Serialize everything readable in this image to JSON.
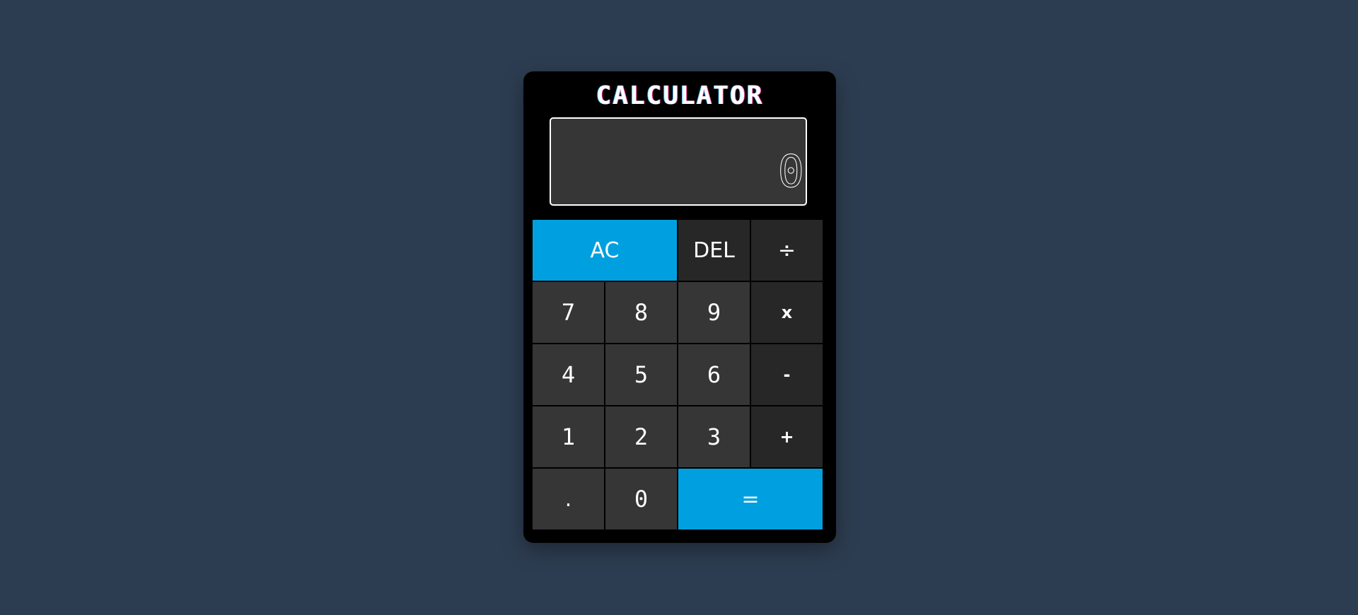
{
  "app": {
    "title": "CALCULATOR"
  },
  "display": {
    "value": "0"
  },
  "colors": {
    "background": "#2d3d51",
    "body": "#000000",
    "key": "#363636",
    "operator_key": "#272727",
    "accent": "#00a0e0",
    "text": "#ffffff"
  },
  "keys": {
    "clear": "AC",
    "delete": "DEL",
    "divide": "÷",
    "seven": "7",
    "eight": "8",
    "nine": "9",
    "multiply": "x",
    "four": "4",
    "five": "5",
    "six": "6",
    "subtract": "-",
    "one": "1",
    "two": "2",
    "three": "3",
    "add": "+",
    "decimal": ".",
    "zero": "0",
    "equals": "="
  }
}
